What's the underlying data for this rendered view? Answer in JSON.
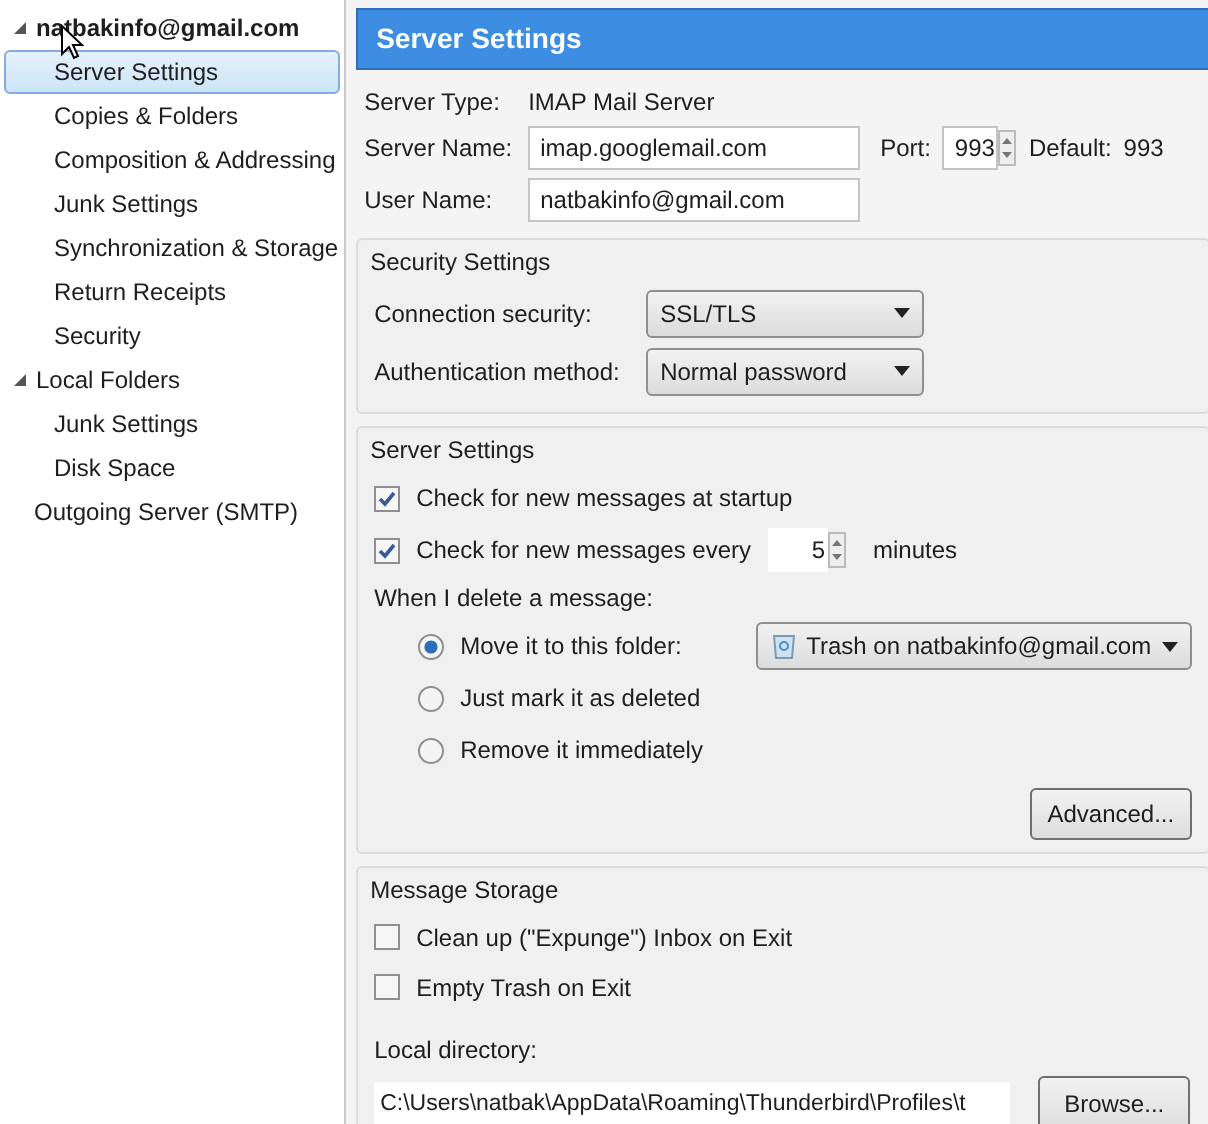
{
  "sidebar": {
    "items": [
      {
        "label": "natbakinfo@gmail.com",
        "expanded": true,
        "selected": false,
        "children": [
          {
            "label": "Server Settings",
            "selected": true
          },
          {
            "label": "Copies & Folders",
            "selected": false
          },
          {
            "label": "Composition & Addressing",
            "selected": false
          },
          {
            "label": "Junk Settings",
            "selected": false
          },
          {
            "label": "Synchronization & Storage",
            "selected": false
          },
          {
            "label": "Return Receipts",
            "selected": false
          },
          {
            "label": "Security",
            "selected": false
          }
        ]
      },
      {
        "label": "Local Folders",
        "expanded": true,
        "selected": false,
        "children": [
          {
            "label": "Junk Settings",
            "selected": false
          },
          {
            "label": "Disk Space",
            "selected": false
          }
        ]
      },
      {
        "label": "Outgoing Server (SMTP)",
        "selected": false
      }
    ]
  },
  "header": {
    "title": "Server Settings"
  },
  "server": {
    "type_label": "Server Type:",
    "type_value": "IMAP Mail Server",
    "name_label": "Server Name:",
    "name_value": "imap.googlemail.com",
    "port_label": "Port:",
    "port_value": "993",
    "default_label": "Default:",
    "default_value": "993",
    "user_label": "User Name:",
    "user_value": "natbakinfo@gmail.com"
  },
  "security": {
    "title": "Security Settings",
    "fields": [
      {
        "label": "Connection security:",
        "value": "SSL/TLS"
      },
      {
        "label": "Authentication method:",
        "value": "Normal password"
      }
    ]
  },
  "server_settings": {
    "title": "Server Settings",
    "checks": [
      {
        "label": "Check for new messages at startup",
        "checked": true
      },
      {
        "label": "Check for new messages every",
        "checked": true,
        "value": "5",
        "suffix": "minutes"
      }
    ],
    "delete_label": "When I delete a message:",
    "delete_options": [
      {
        "label": "Move it to this folder:",
        "selected": true,
        "folder": "Trash on natbakinfo@gmail.com"
      },
      {
        "label": "Just mark it as deleted",
        "selected": false
      },
      {
        "label": "Remove it immediately",
        "selected": false
      }
    ],
    "advanced_button": "Advanced..."
  },
  "storage": {
    "title": "Message Storage",
    "checks": [
      {
        "label": "Clean up (\"Expunge\") Inbox on Exit",
        "checked": false
      },
      {
        "label": "Empty Trash on Exit",
        "checked": false
      }
    ],
    "directory_label": "Local directory:",
    "directory_value": "C:\\Users\\natbak\\AppData\\Roaming\\Thunderbird\\Profiles\\t",
    "browse_button": "Browse..."
  }
}
